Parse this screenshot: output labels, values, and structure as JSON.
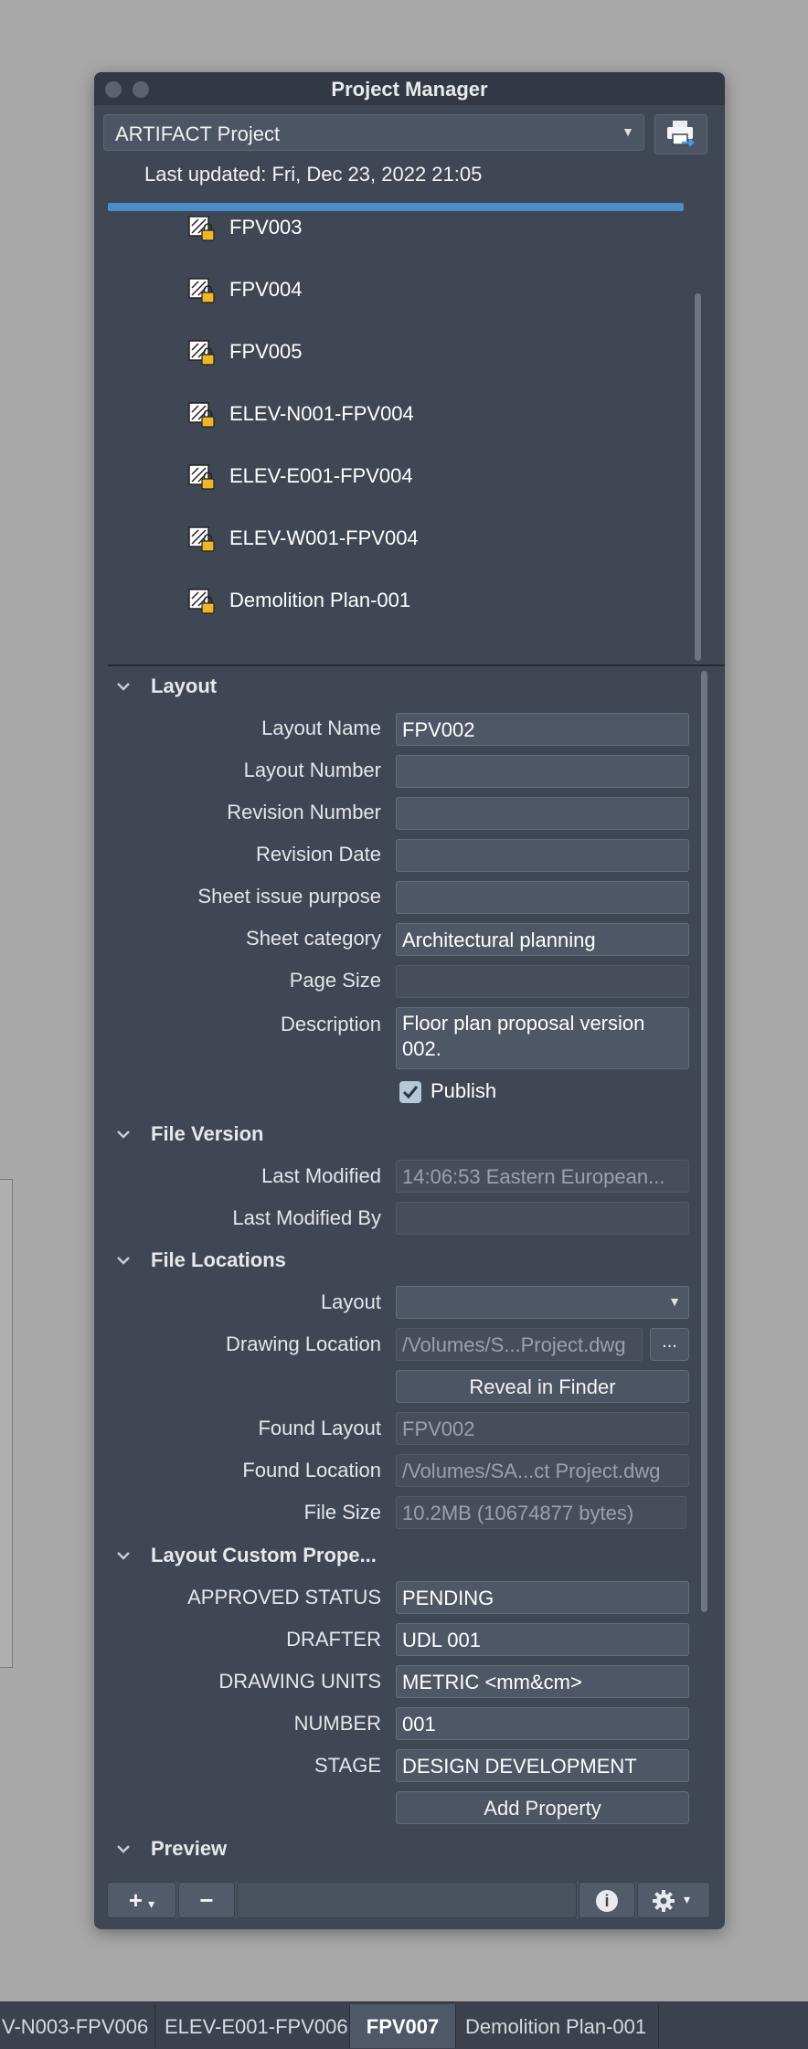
{
  "window": {
    "title": "Project Manager"
  },
  "project": {
    "selected": "ARTIFACT Project",
    "last_updated": "Last updated: Fri, Dec 23, 2022 21:05"
  },
  "items": [
    {
      "label": "FPV003"
    },
    {
      "label": "FPV004"
    },
    {
      "label": "FPV005"
    },
    {
      "label": "ELEV-N001-FPV004"
    },
    {
      "label": "ELEV-E001-FPV004"
    },
    {
      "label": "ELEV-W001-FPV004"
    },
    {
      "label": "Demolition Plan-001"
    }
  ],
  "sections": {
    "layout": "Layout",
    "file_version": "File Version",
    "file_locations": "File Locations",
    "custom_props": "Layout Custom Prope...",
    "preview": "Preview"
  },
  "layout_props": {
    "layout_name": {
      "label": "Layout Name",
      "value": "FPV002"
    },
    "layout_number": {
      "label": "Layout Number",
      "value": ""
    },
    "revision_number": {
      "label": "Revision Number",
      "value": ""
    },
    "revision_date": {
      "label": "Revision Date",
      "value": ""
    },
    "sheet_issue_purpose": {
      "label": "Sheet issue purpose",
      "value": ""
    },
    "sheet_category": {
      "label": "Sheet category",
      "value": "Architectural planning"
    },
    "page_size": {
      "label": "Page Size",
      "value": ""
    },
    "description": {
      "label": "Description",
      "value": "Floor plan proposal version 002."
    },
    "publish": {
      "label": "Publish",
      "checked": true
    }
  },
  "file_version": {
    "last_modified": {
      "label": "Last Modified",
      "value": "14:06:53 Eastern European..."
    },
    "last_modified_by": {
      "label": "Last Modified By",
      "value": ""
    }
  },
  "file_locations": {
    "layout": {
      "label": "Layout",
      "value": ""
    },
    "drawing_location": {
      "label": "Drawing Location",
      "value": "/Volumes/S...Project.dwg",
      "browse": "..."
    },
    "reveal_button": "Reveal in Finder",
    "found_layout": {
      "label": "Found Layout",
      "value": "FPV002"
    },
    "found_location": {
      "label": "Found Location",
      "value": "/Volumes/SA...ct Project.dwg"
    },
    "file_size": {
      "label": "File Size",
      "value": "10.2MB (10674877 bytes)"
    }
  },
  "custom_props": {
    "approved_status": {
      "label": "APPROVED STATUS",
      "value": "PENDING"
    },
    "drafter": {
      "label": "DRAFTER",
      "value": "UDL 001"
    },
    "drawing_units": {
      "label": "DRAWING UNITS",
      "value": "METRIC <mm&cm>"
    },
    "number": {
      "label": "NUMBER",
      "value": "001"
    },
    "stage": {
      "label": "STAGE",
      "value": "DESIGN DEVELOPMENT"
    },
    "add_button": "Add Property"
  },
  "toolbar": {
    "add": "+",
    "add_arrow": "▾",
    "remove": "−",
    "info": "i",
    "gear_arrow": "▾"
  },
  "bottom_tabs": [
    {
      "label": "V-N003-FPV006"
    },
    {
      "label": "ELEV-E001-FPV006"
    },
    {
      "label": "FPV007",
      "active": true
    },
    {
      "label": "Demolition Plan-001"
    }
  ],
  "colors": {
    "panel_bg": "#3f4754",
    "accent_progress": "#4a8dc8",
    "lock": "#f0b62a"
  }
}
